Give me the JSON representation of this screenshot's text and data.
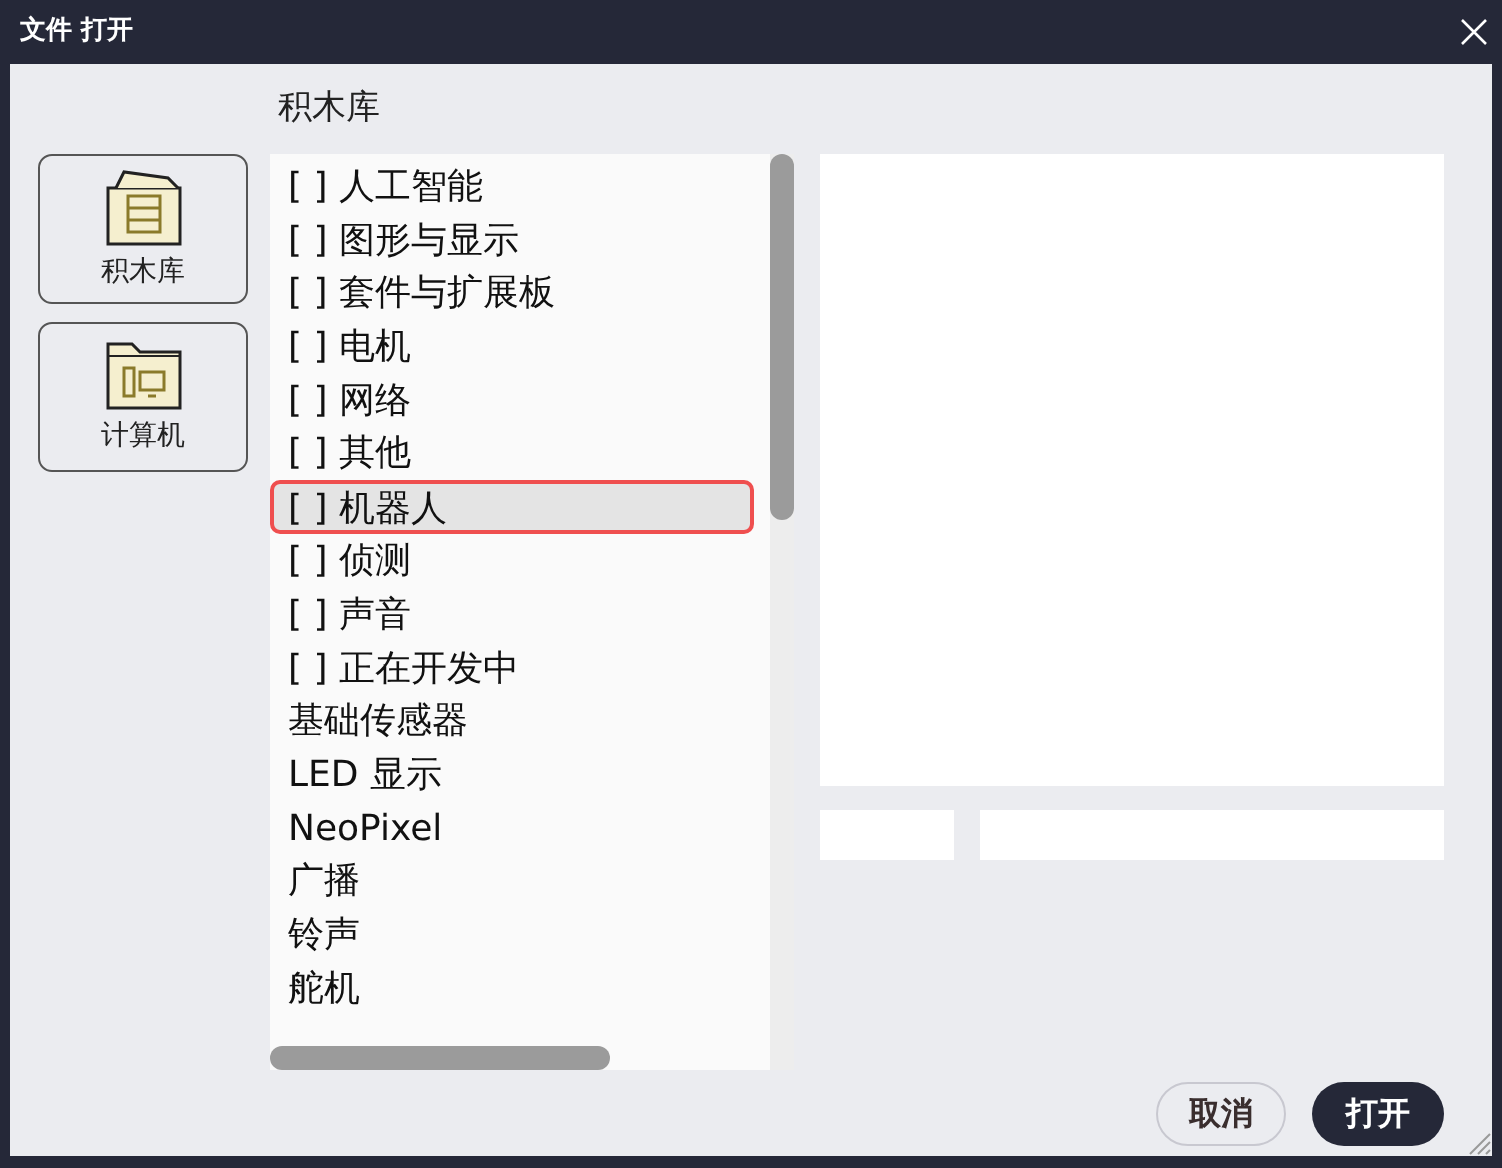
{
  "window": {
    "title": "文件 打开"
  },
  "heading": "积木库",
  "sidebar": [
    {
      "label": "积木库",
      "kind": "library"
    },
    {
      "label": "计算机",
      "kind": "computer"
    }
  ],
  "list": [
    {
      "label": "[ ] 人工智能",
      "selected": false
    },
    {
      "label": "[ ] 图形与显示",
      "selected": false
    },
    {
      "label": "[ ] 套件与扩展板",
      "selected": false
    },
    {
      "label": "[ ] 电机",
      "selected": false
    },
    {
      "label": "[ ] 网络",
      "selected": false
    },
    {
      "label": "[ ] 其他",
      "selected": false
    },
    {
      "label": "[ ] 机器人",
      "selected": true
    },
    {
      "label": "[ ] 侦测",
      "selected": false
    },
    {
      "label": "[ ] 声音",
      "selected": false
    },
    {
      "label": "[ ] 正在开发中",
      "selected": false
    },
    {
      "label": "基础传感器",
      "selected": false
    },
    {
      "label": "LED 显示",
      "selected": false
    },
    {
      "label": "NeoPixel",
      "selected": false
    },
    {
      "label": "广播",
      "selected": false
    },
    {
      "label": "铃声",
      "selected": false
    },
    {
      "label": "舵机",
      "selected": false
    }
  ],
  "buttons": [
    {
      "label": "取消",
      "kind": "secondary"
    },
    {
      "label": "打开",
      "kind": "primary"
    }
  ]
}
